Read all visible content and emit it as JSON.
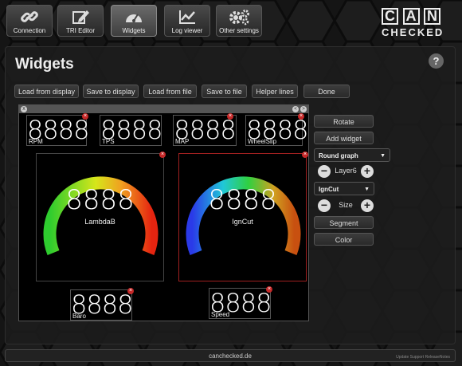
{
  "nav": [
    {
      "label": "Connection",
      "icon": "link-icon"
    },
    {
      "label": "TRI Editor",
      "icon": "pencil-edit-icon"
    },
    {
      "label": "Widgets",
      "icon": "speedometer-icon",
      "active": true
    },
    {
      "label": "Log viewer",
      "icon": "line-chart-icon"
    },
    {
      "label": "Other settings",
      "icon": "gears-icon"
    }
  ],
  "logo": {
    "letters": [
      "C",
      "A",
      "N"
    ],
    "sub": "CHECKED"
  },
  "page": {
    "title": "Widgets",
    "help": "?"
  },
  "toolbar": [
    "Load from display",
    "Save to display",
    "Load from file",
    "Save to file",
    "Helper lines",
    "Done"
  ],
  "canvas": {
    "close": "x",
    "prev": "<",
    "next": ">",
    "numbers": [
      {
        "value": "8888",
        "label": "RPM"
      },
      {
        "value": "8888",
        "label": "TPS"
      },
      {
        "value": "8888",
        "label": "MAP"
      },
      {
        "value": "8888",
        "label": "WheelSlip"
      },
      {
        "value": "8888",
        "label": "Baro"
      },
      {
        "value": "8888",
        "label": "Speed"
      }
    ],
    "gauges": [
      {
        "value": "8888",
        "label": "LambdaB",
        "selected": false
      },
      {
        "value": "8888",
        "label": "IgnCut",
        "selected": true
      }
    ]
  },
  "sidepanel": {
    "rotate": "Rotate",
    "add_widget": "Add widget",
    "widget_type": "Round graph",
    "layer": "Layer6",
    "channel": "IgnCut",
    "size": "Size",
    "segment": "Segment",
    "color": "Color",
    "minus": "−",
    "plus": "+"
  },
  "footer": {
    "site": "canchecked.de",
    "links": "Update  Support  ReleaseNotes"
  }
}
